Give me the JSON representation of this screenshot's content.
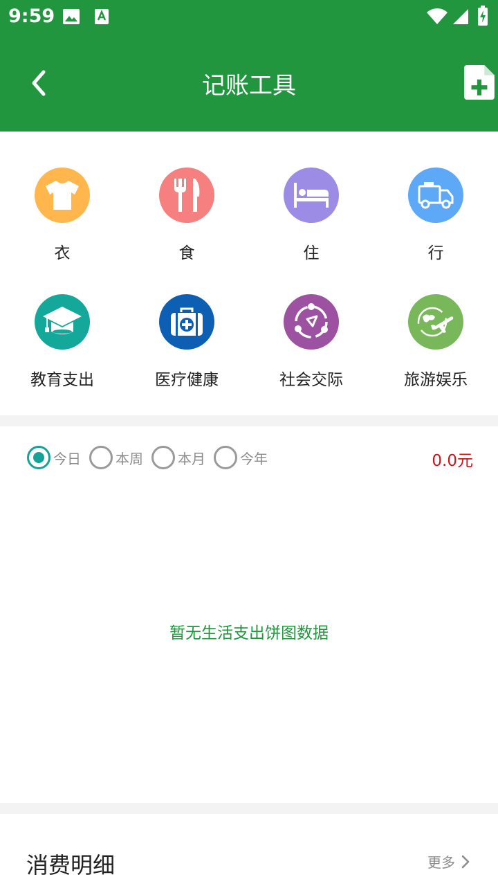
{
  "status_bar": {
    "time": "9:59",
    "icons": [
      "image-icon",
      "font-a-icon",
      "wifi-icon",
      "signal-icon",
      "battery-charging-icon"
    ]
  },
  "app_bar": {
    "title": "记账工具",
    "back_icon": "chevron-left-icon",
    "action_icon": "file-add-icon"
  },
  "categories": [
    {
      "label": "衣",
      "icon": "tshirt-icon",
      "color": "#ffb74d"
    },
    {
      "label": "食",
      "icon": "fork-knife-icon",
      "color": "#f67f7f"
    },
    {
      "label": "住",
      "icon": "bed-icon",
      "color": "#9c8ce5"
    },
    {
      "label": "行",
      "icon": "truck-icon",
      "color": "#5ea8f8"
    },
    {
      "label": "教育支出",
      "icon": "graduation-cap-icon",
      "color": "#13a89a"
    },
    {
      "label": "医疗健康",
      "icon": "medical-kit-icon",
      "color": "#0d5fb3"
    },
    {
      "label": "社会交际",
      "icon": "social-orbit-icon",
      "color": "#9c52a1"
    },
    {
      "label": "旅游娱乐",
      "icon": "globe-plane-icon",
      "color": "#78b85a"
    }
  ],
  "period": {
    "options": [
      "今日",
      "本周",
      "本月",
      "今年"
    ],
    "selected": "今日",
    "total": "0.0元"
  },
  "chart": {
    "empty_message": "暂无生活支出饼图数据"
  },
  "details": {
    "title": "消费明细",
    "more_label": "更多"
  },
  "colors": {
    "primary": "#21963e",
    "radio_active": "#14a396",
    "amount": "#c8161d"
  }
}
